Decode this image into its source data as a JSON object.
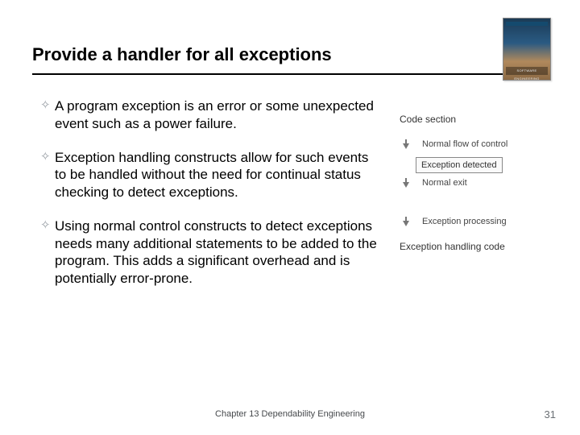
{
  "title": "Provide a handler for all exceptions",
  "bullets": [
    "A program exception is an error or some unexpected event such as a power failure.",
    "Exception handling constructs allow for such events to be handled without the need for continual status checking to detect exceptions.",
    "Using normal control constructs to detect exceptions needs many additional statements to be added to the program. This adds a significant overhead and is potentially error-prone."
  ],
  "diagram": {
    "header": "Code section",
    "normal_flow": "Normal flow of control",
    "exception_detected": "Exception detected",
    "normal_exit": "Normal exit",
    "exception_processing": "Exception processing",
    "footer": "Exception handling code"
  },
  "footer": "Chapter 13 Dependability Engineering",
  "page_number": "31",
  "book_cover": "SOFTWARE ENGINEERING"
}
